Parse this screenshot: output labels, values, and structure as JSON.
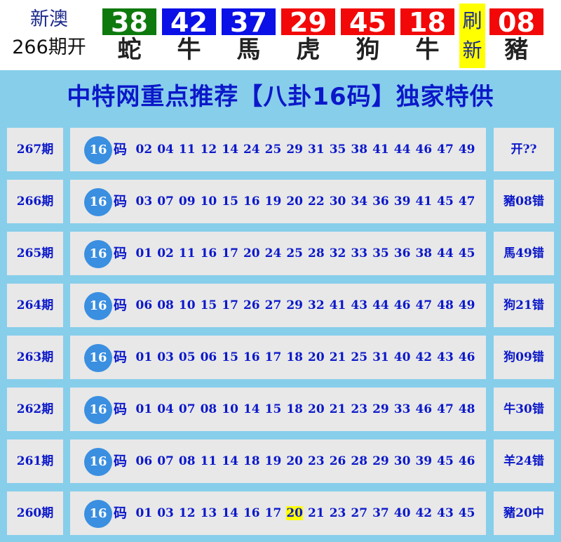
{
  "header": {
    "site": "新澳",
    "draw": "266期开",
    "balls": [
      {
        "num": "38",
        "zodiac": "蛇",
        "color": "#0e7a0e"
      },
      {
        "num": "42",
        "zodiac": "牛",
        "color": "#0a10e6"
      },
      {
        "num": "37",
        "zodiac": "馬",
        "color": "#0a10e6"
      },
      {
        "num": "29",
        "zodiac": "虎",
        "color": "#f20808"
      },
      {
        "num": "45",
        "zodiac": "狗",
        "color": "#f20808"
      },
      {
        "num": "18",
        "zodiac": "牛",
        "color": "#f20808"
      }
    ],
    "refresh_1": "刷",
    "refresh_2": "新",
    "special": {
      "num": "08",
      "zodiac": "豬",
      "color": "#f20808"
    }
  },
  "title": "中特网重点推荐【八卦16码】独家特供",
  "rows": [
    {
      "period": "267期",
      "badge": "16",
      "ma": "码",
      "numbers": [
        "02",
        "04",
        "11",
        "12",
        "14",
        "24",
        "25",
        "29",
        "31",
        "35",
        "38",
        "41",
        "44",
        "46",
        "47",
        "49"
      ],
      "result": "开??",
      "highlight": ""
    },
    {
      "period": "266期",
      "badge": "16",
      "ma": "码",
      "numbers": [
        "03",
        "07",
        "09",
        "10",
        "15",
        "16",
        "19",
        "20",
        "22",
        "30",
        "34",
        "36",
        "39",
        "41",
        "45",
        "47"
      ],
      "result": "豬08错",
      "highlight": ""
    },
    {
      "period": "265期",
      "badge": "16",
      "ma": "码",
      "numbers": [
        "01",
        "02",
        "11",
        "16",
        "17",
        "20",
        "24",
        "25",
        "28",
        "32",
        "33",
        "35",
        "36",
        "38",
        "44",
        "45"
      ],
      "result": "馬49错",
      "highlight": ""
    },
    {
      "period": "264期",
      "badge": "16",
      "ma": "码",
      "numbers": [
        "06",
        "08",
        "10",
        "15",
        "17",
        "26",
        "27",
        "29",
        "32",
        "41",
        "43",
        "44",
        "46",
        "47",
        "48",
        "49"
      ],
      "result": "狗21错",
      "highlight": ""
    },
    {
      "period": "263期",
      "badge": "16",
      "ma": "码",
      "numbers": [
        "01",
        "03",
        "05",
        "06",
        "15",
        "16",
        "17",
        "18",
        "20",
        "21",
        "25",
        "31",
        "40",
        "42",
        "43",
        "46"
      ],
      "result": "狗09错",
      "highlight": ""
    },
    {
      "period": "262期",
      "badge": "16",
      "ma": "码",
      "numbers": [
        "01",
        "04",
        "07",
        "08",
        "10",
        "14",
        "15",
        "18",
        "20",
        "21",
        "23",
        "29",
        "33",
        "46",
        "47",
        "48"
      ],
      "result": "牛30错",
      "highlight": ""
    },
    {
      "period": "261期",
      "badge": "16",
      "ma": "码",
      "numbers": [
        "06",
        "07",
        "08",
        "11",
        "14",
        "18",
        "19",
        "20",
        "23",
        "26",
        "28",
        "29",
        "30",
        "39",
        "45",
        "46"
      ],
      "result": "羊24错",
      "highlight": ""
    },
    {
      "period": "260期",
      "badge": "16",
      "ma": "码",
      "numbers": [
        "01",
        "03",
        "12",
        "13",
        "14",
        "16",
        "17",
        "20",
        "21",
        "23",
        "27",
        "37",
        "40",
        "42",
        "43",
        "45"
      ],
      "result": "豬20中",
      "highlight": "20"
    }
  ]
}
